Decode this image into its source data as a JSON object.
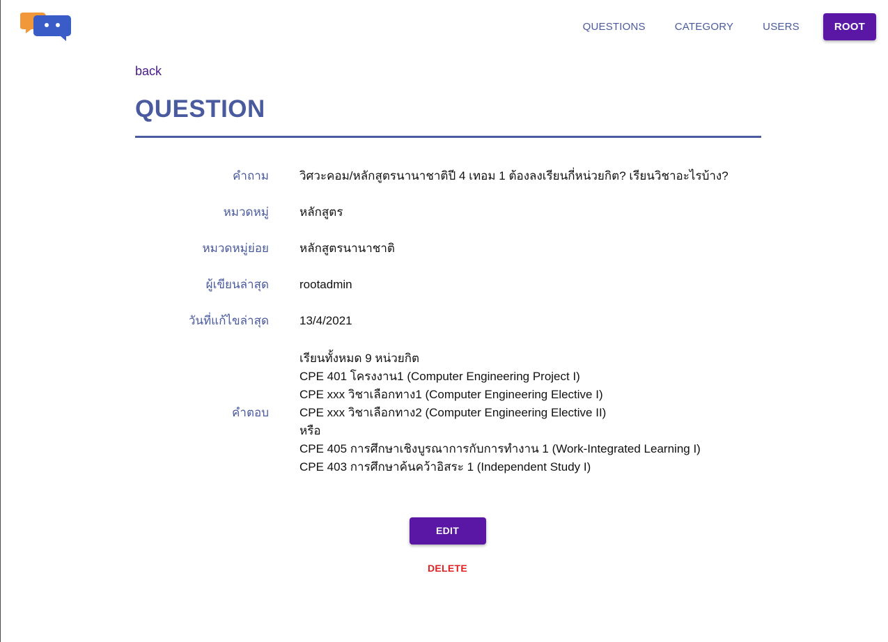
{
  "colors": {
    "brand_purple": "#5a17a6",
    "nav_text": "#4a5a9e",
    "label_text": "#4a5a9e",
    "title_text": "#4a5a9e",
    "rule": "#4a5a9e",
    "back_link": "#4a1a8c",
    "delete_red": "#e02020",
    "logo_orange": "#f0983a",
    "logo_blue": "#3a5cc7"
  },
  "header": {
    "logo_icon": "chat-bubbles-logo-icon",
    "nav": [
      {
        "label": "QUESTIONS"
      },
      {
        "label": "CATEGORY"
      },
      {
        "label": "USERS"
      },
      {
        "label": "ROOT",
        "active": true
      }
    ]
  },
  "main": {
    "back_label": "back",
    "title": "QUESTION",
    "fields": {
      "question": {
        "label": "คำถาม",
        "value": "วิศวะคอม/หลักสูตรนานาชาติปี 4 เทอม 1 ต้องลงเรียนกี่หน่วยกิต? เรียนวิชาอะไรบ้าง?"
      },
      "category": {
        "label": "หมวดหมู่",
        "value": "หลักสูตร"
      },
      "subcategory": {
        "label": "หมวดหมู่ย่อย",
        "value": "หลักสูตรนานาชาติ"
      },
      "last_author": {
        "label": "ผู้เขียนล่าสุด",
        "value": "rootadmin"
      },
      "last_edited": {
        "label": "วันที่แก้ไขล่าสุด",
        "value": "13/4/2021"
      },
      "answer": {
        "label": "คำตอบ",
        "lines": [
          "เรียนทั้งหมด 9 หน่วยกิต",
          "CPE 401 โครงงาน1 (Computer Engineering Project I)",
          "CPE xxx วิชาเลือกทาง1 (Computer Engineering Elective I)",
          "CPE xxx วิชาเลือกทาง2 (Computer Engineering Elective II)",
          "หรือ",
          "CPE 405 การศึกษาเชิงบูรณาการกับการทำงาน 1 (Work-Integrated Learning I)",
          "CPE 403 การศึกษาค้นคว้าอิสระ 1 (Independent Study I)"
        ]
      }
    },
    "actions": {
      "edit_label": "EDIT",
      "delete_label": "DELETE"
    }
  }
}
